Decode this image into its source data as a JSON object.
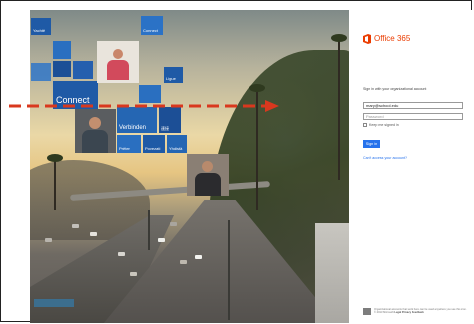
{
  "brand": {
    "product_name": "Office 365",
    "accent_color": "#eb3c00",
    "icon": "office-logo-icon"
  },
  "tiles": {
    "tile_1": "Yachtë",
    "tile_2": "Connect",
    "tile_3": "Ligue",
    "tile_4": "Connect",
    "tile_5": "Verbinden",
    "tile_6": "連接",
    "tile_7": "Prêter",
    "tile_8": "Povezati",
    "tile_9": "Yhdistä"
  },
  "signin": {
    "prompt": "Sign in with your organizational account",
    "username_value": "mary@school.edu",
    "password_placeholder": "Password",
    "keep_signed_in_label": "Keep me signed in",
    "submit_label": "Sign in",
    "cant_access_link": "Can't access your account?"
  },
  "footer": {
    "text": "Organizational accounts that work here can be used anywhere you see this icon. © 2013 Microsoft",
    "links": "Legal  Privacy  Feedback",
    "icon": "organizational-account-icon"
  },
  "colors": {
    "button_blue": "#2672ec",
    "arrow_red": "#d9381e",
    "tile_blue": "#1f5aa6"
  }
}
